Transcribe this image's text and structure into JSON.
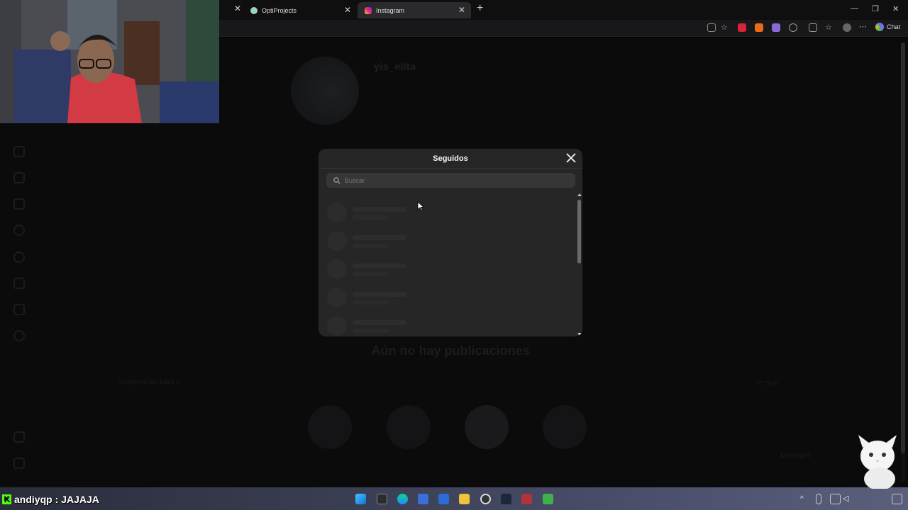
{
  "browser": {
    "tabs": [
      {
        "title": "OptiProjects",
        "active": false
      },
      {
        "title": "Instagram",
        "active": true
      }
    ],
    "chat_label": "Chat"
  },
  "profile": {
    "username": "yis_elita",
    "no_posts_text": "Aún no hay publicaciones",
    "suggestions_title": "Sugerencias para ti",
    "see_all": "Ver todo",
    "messages_label": "Mensajes"
  },
  "modal": {
    "title": "Seguidos",
    "search_placeholder": "Buscar"
  },
  "stream": {
    "chat_user": "andiyqp",
    "chat_message": ": JAJAJA"
  },
  "colors": {
    "modal_bg": "#262626",
    "page_bg": "#0b0b0c",
    "kick_green": "#53fc18"
  }
}
